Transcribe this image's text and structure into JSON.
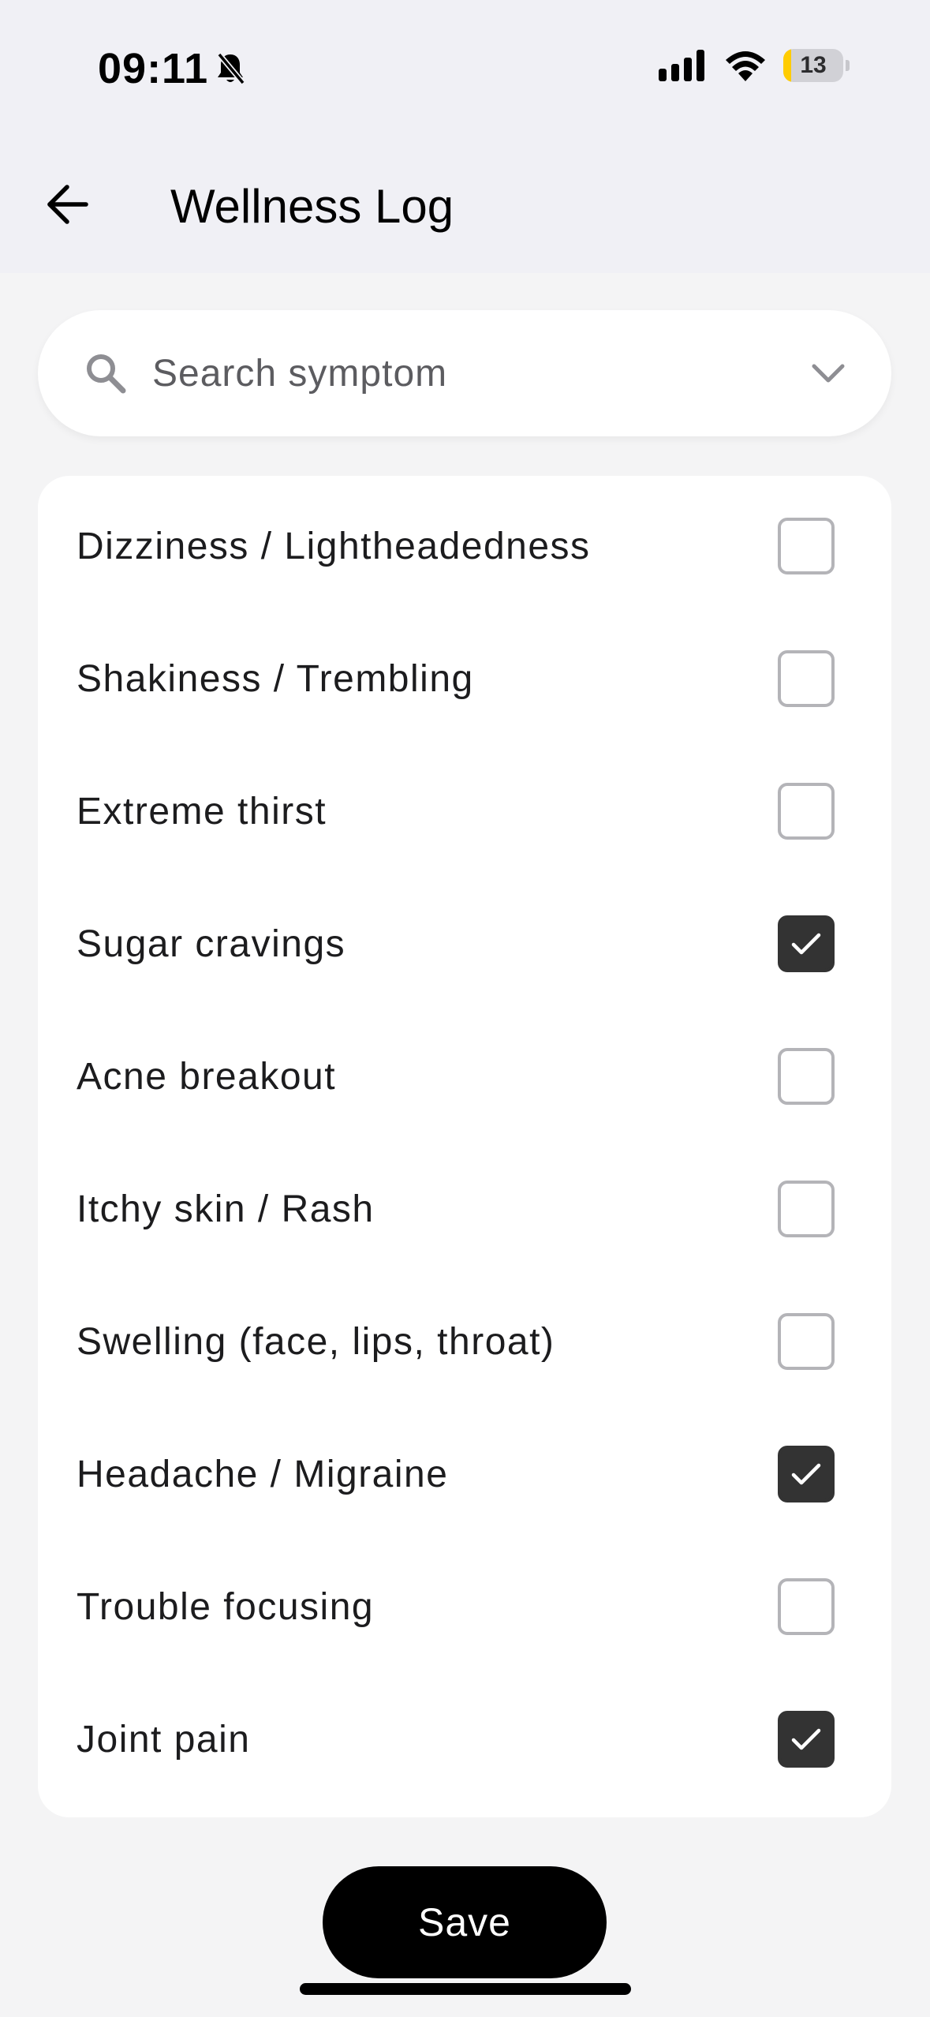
{
  "status_bar": {
    "time": "09:11",
    "battery_level": "13",
    "icons": [
      "bell-slash-icon",
      "cellular-signal-icon",
      "wifi-icon",
      "battery-icon"
    ]
  },
  "header": {
    "back_icon": "arrow-left-icon",
    "title": "Wellness Log"
  },
  "search": {
    "placeholder": "Search symptom",
    "value": "",
    "icon": "search-icon",
    "dropdown_icon": "chevron-down-icon"
  },
  "symptoms": [
    {
      "label": "Dizziness / Lightheadedness",
      "checked": false
    },
    {
      "label": "Shakiness / Trembling",
      "checked": false
    },
    {
      "label": "Extreme thirst",
      "checked": false
    },
    {
      "label": "Sugar cravings",
      "checked": true
    },
    {
      "label": "Acne breakout",
      "checked": false
    },
    {
      "label": "Itchy skin / Rash",
      "checked": false
    },
    {
      "label": "Swelling (face, lips, throat)",
      "checked": false
    },
    {
      "label": "Headache / Migraine",
      "checked": true
    },
    {
      "label": "Trouble focusing",
      "checked": false
    },
    {
      "label": "Joint pain",
      "checked": true
    }
  ],
  "actions": {
    "save_label": "Save"
  },
  "colors": {
    "background": "#f4f4f5",
    "header_background": "#f0f0f5",
    "card_background": "#ffffff",
    "checkbox_checked": "#333333",
    "checkbox_border": "#b4b4b8",
    "button_background": "#000000",
    "battery_accent": "#ffcc00"
  }
}
